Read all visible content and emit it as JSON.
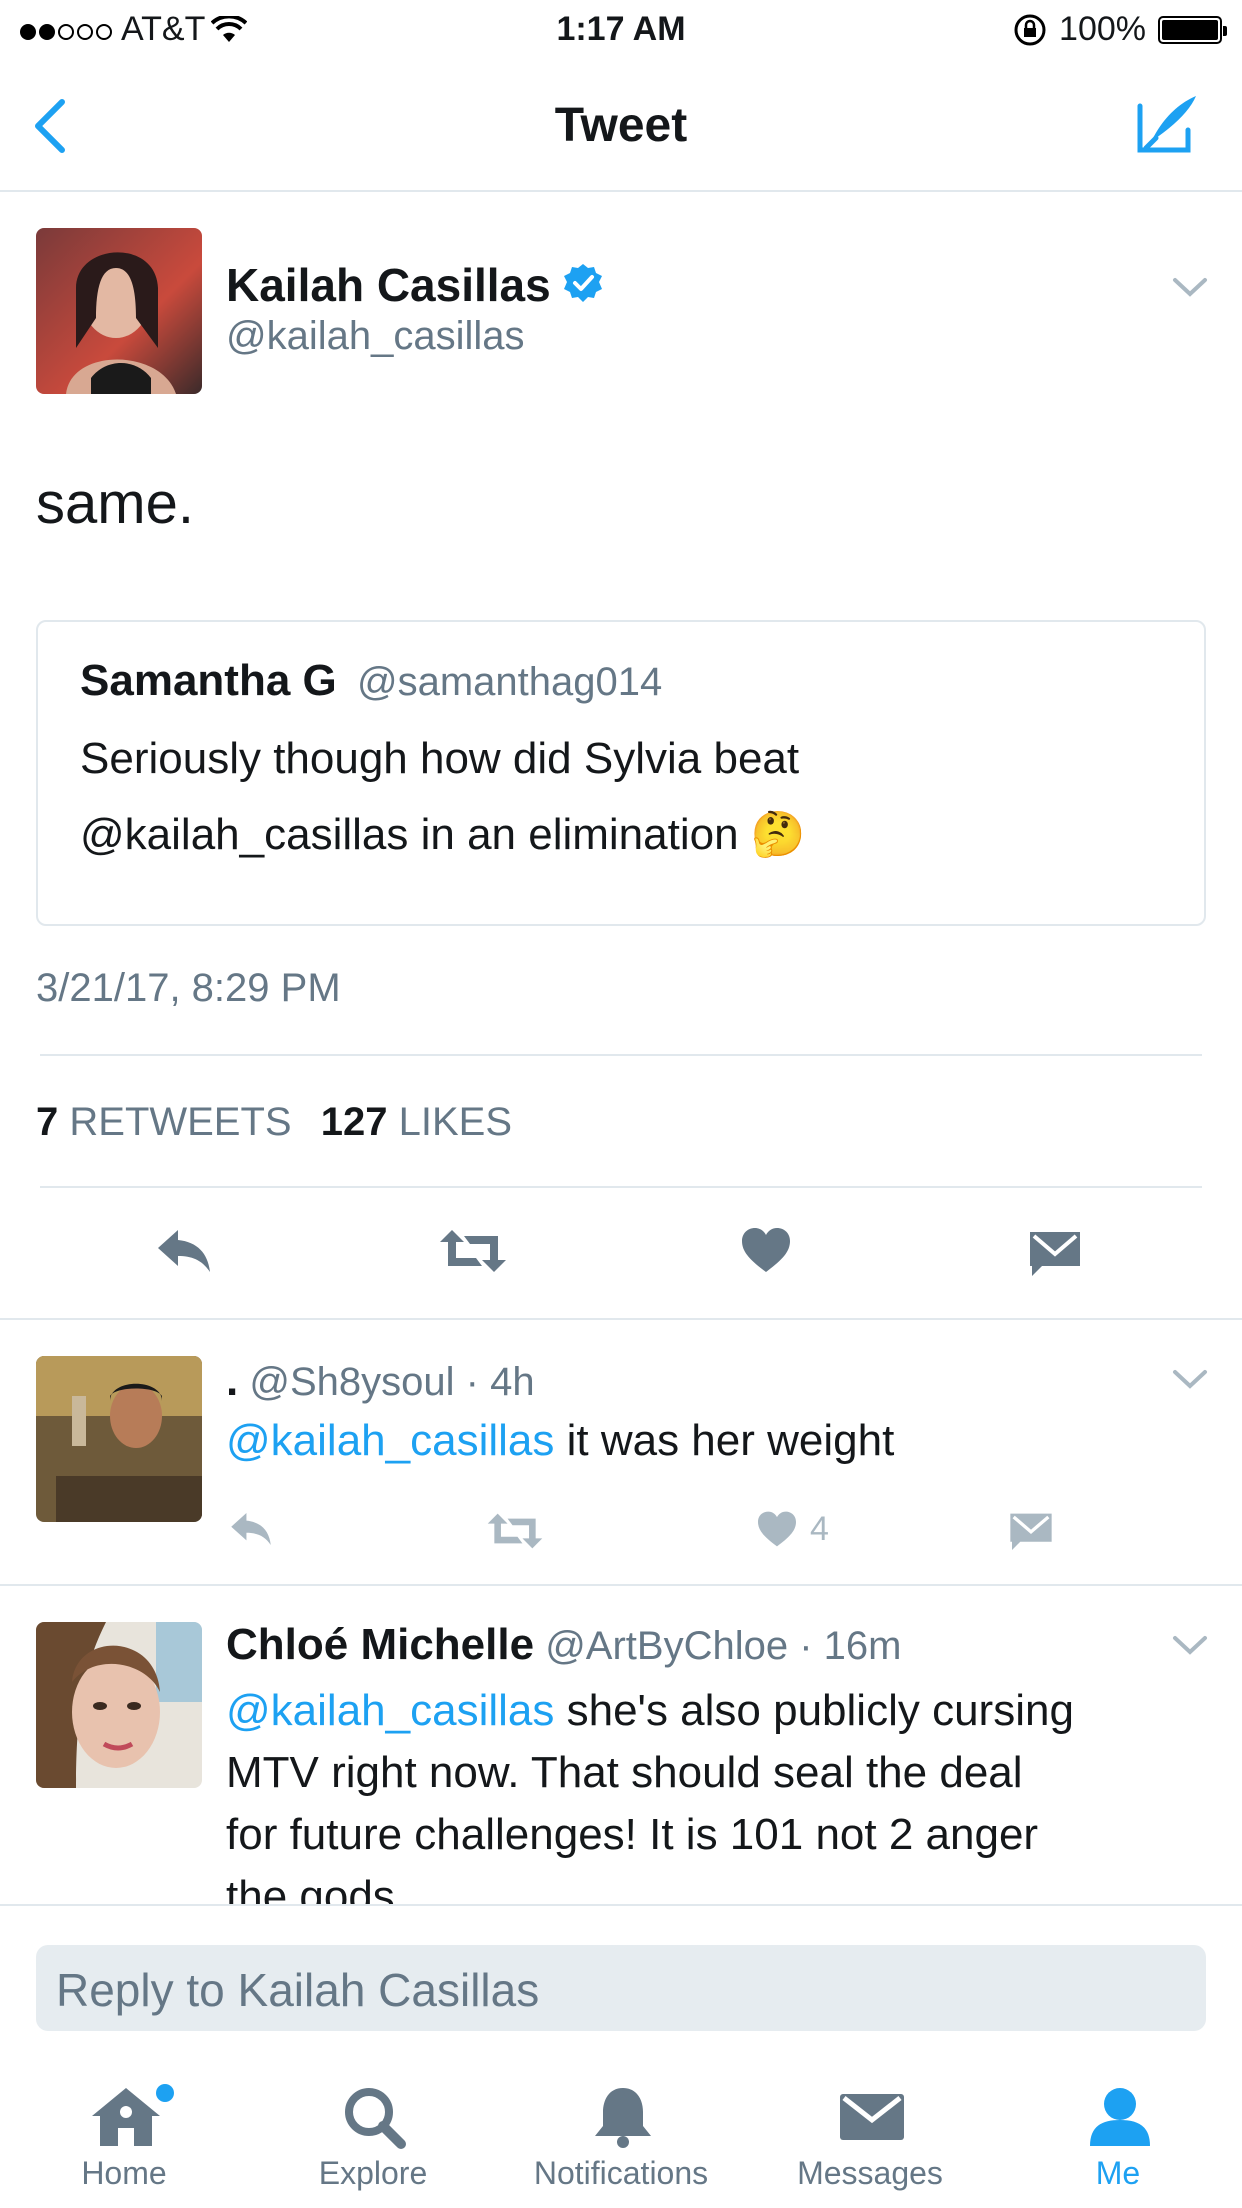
{
  "status_bar": {
    "carrier": "AT&T",
    "time": "1:17 AM",
    "battery": "100%"
  },
  "nav": {
    "title": "Tweet"
  },
  "tweet": {
    "author_name": "Kailah Casillas",
    "author_handle": "@kailah_casillas",
    "verified": true,
    "text": "same.",
    "quoted": {
      "author_name": "Samantha G",
      "author_handle": "@samanthag014",
      "line1": "Seriously though how did Sylvia beat",
      "line2": "@kailah_casillas in an elimination",
      "emoji": "🤔"
    },
    "timestamp": "3/21/17, 8:29 PM",
    "retweets_count": "7",
    "retweets_label": "RETWEETS",
    "likes_count": "127",
    "likes_label": "LIKES"
  },
  "replies": [
    {
      "name": ".",
      "handle": "@Sh8ysoul",
      "time": "· 4h",
      "mention": "@kailah_casillas",
      "text": " it was her weight",
      "like_count": "4"
    },
    {
      "name": "Chloé Michelle",
      "handle": "@ArtByChloe",
      "time": "· 16m",
      "mention": "@kailah_casillas",
      "line1": " she's also publicly cursing",
      "line2": "MTV right now. That should seal the deal",
      "line3": "for future challenges! It is 101 not 2 anger",
      "line4": "the gods"
    }
  ],
  "reply_box": {
    "placeholder": "Reply to Kailah Casillas"
  },
  "tabs": [
    {
      "label": "Home",
      "icon": "home-icon"
    },
    {
      "label": "Explore",
      "icon": "search-icon"
    },
    {
      "label": "Notifications",
      "icon": "bell-icon"
    },
    {
      "label": "Messages",
      "icon": "envelope-icon"
    },
    {
      "label": "Me",
      "icon": "person-icon"
    }
  ],
  "colors": {
    "accent": "#1da1f2",
    "gray_text": "#657786",
    "divider": "#e1e8ed",
    "icon_gray": "#657786",
    "light_icon": "#aab8c2"
  }
}
